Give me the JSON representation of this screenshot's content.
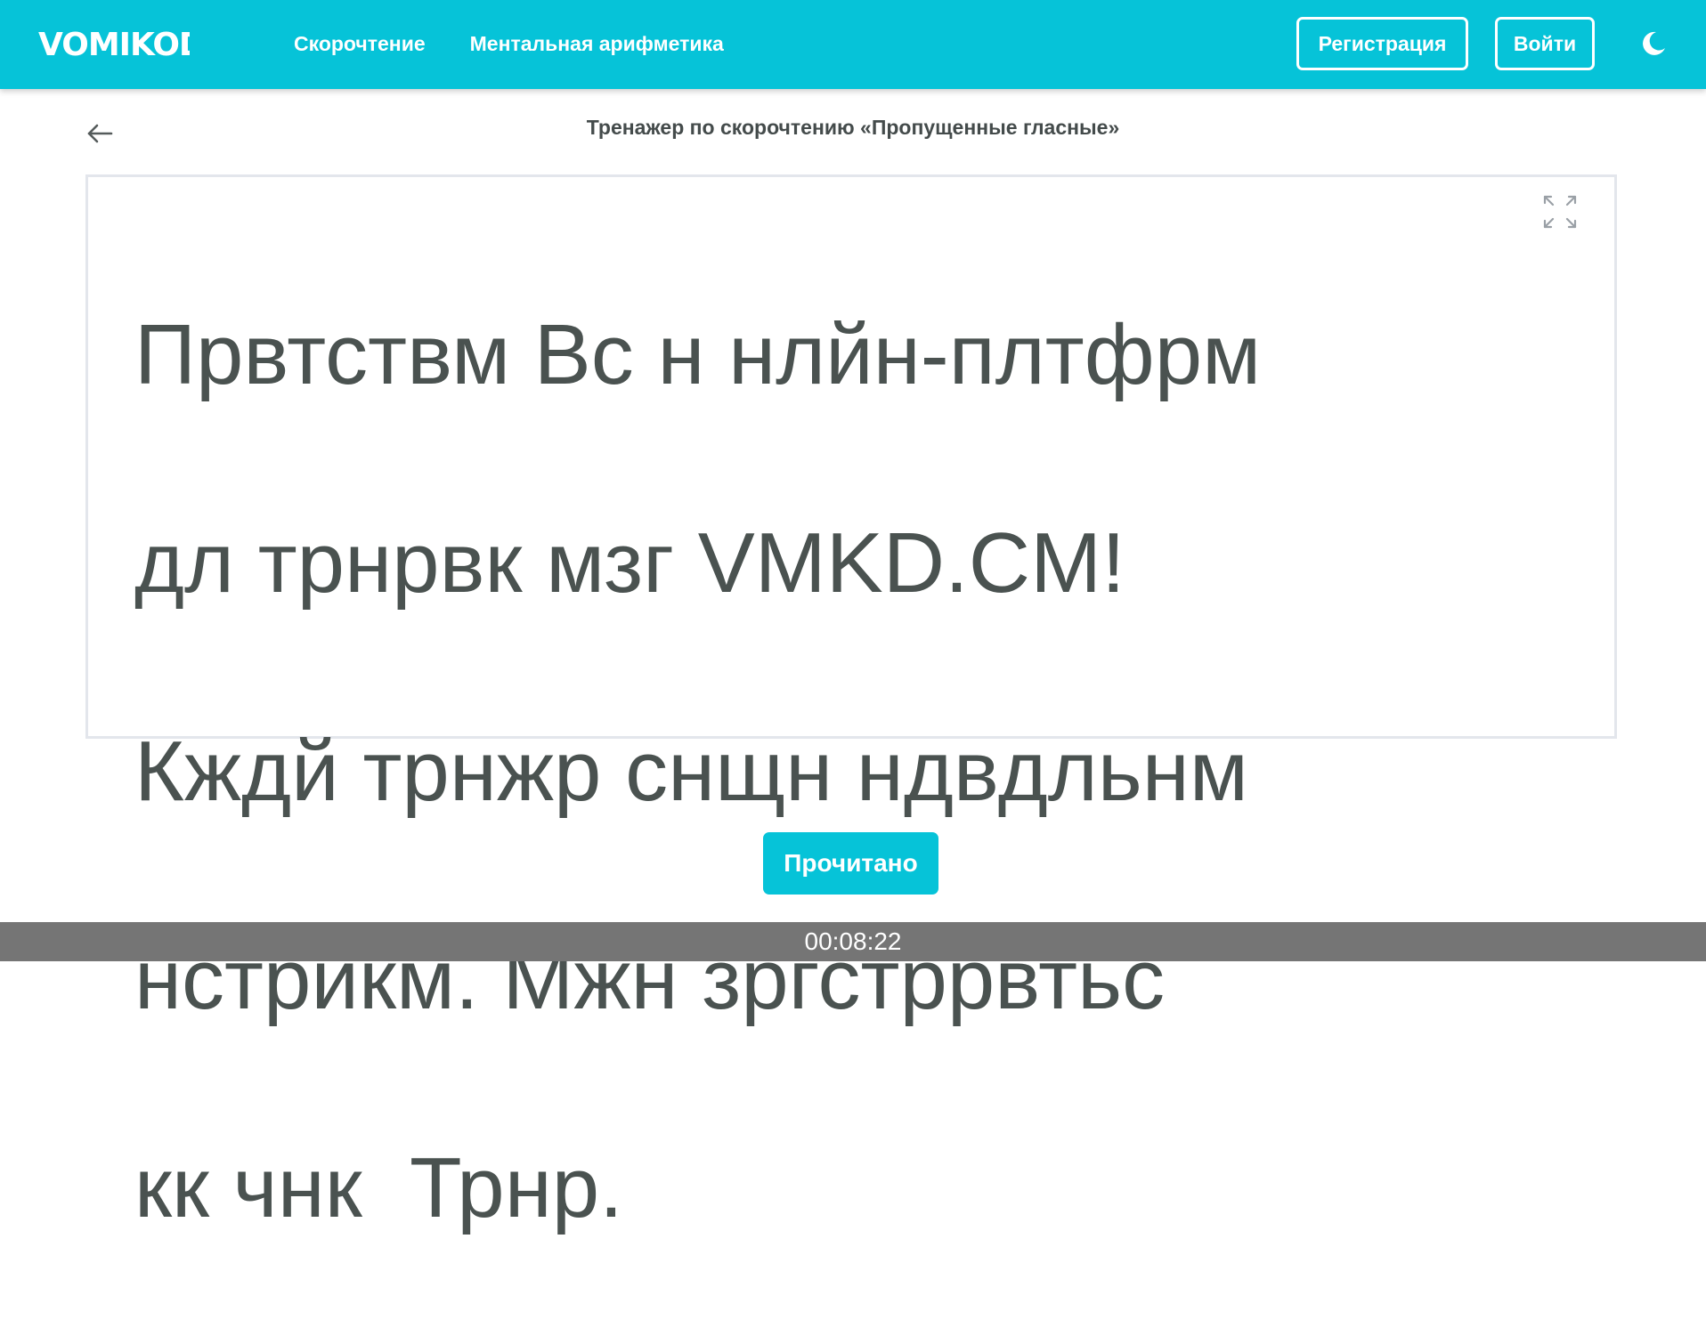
{
  "header": {
    "logo_text": "VOMIKOD",
    "nav": {
      "speed_reading": "Скорочтение",
      "mental_arithmetic": "Ментальная арифметика"
    },
    "register_label": "Регистрация",
    "login_label": "Войти",
    "theme_icon": "moon-icon"
  },
  "page": {
    "back_icon": "arrow-left-icon",
    "title": "Тренажер по скорочтению «Пропущенные гласные»",
    "fullscreen_icon": "expand-icon",
    "reading_lines": [
      "Првтствм Вс н нлйн-плтфрм",
      "дл трнрвк мзг VMKD.CM!",
      "Кждй трнжр снщн ндвдльнм",
      "нстрйкм. Мжн зргстррвтьс",
      "кк чнк  Трнр."
    ],
    "done_label": "Прочитано"
  },
  "footer": {
    "timer": "00:08:22"
  },
  "colors": {
    "accent": "#06c3d8",
    "text": "#4a5250",
    "footer_bg": "#757575",
    "box_border": "#e3e6ec"
  }
}
